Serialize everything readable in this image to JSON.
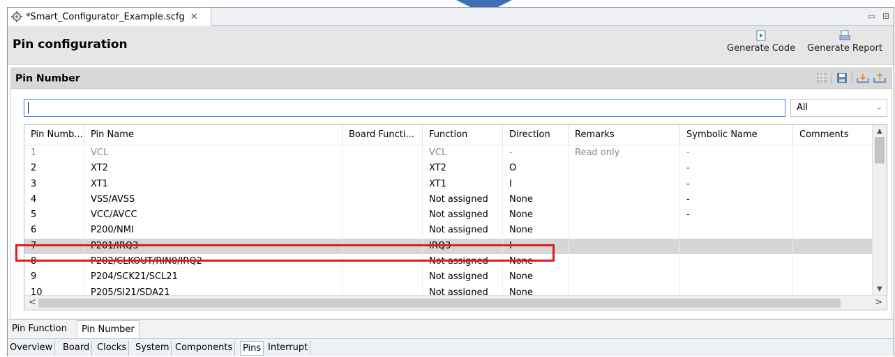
{
  "editor": {
    "tab_title": "*Smart_Configurator_Example.scfg",
    "close_glyph": "✕",
    "minimize_glyph": "▭",
    "maximize_glyph": "⊟"
  },
  "header": {
    "title": "Pin configuration",
    "generate_code": "Generate Code",
    "generate_report": "Generate Report"
  },
  "pane": {
    "title": "Pin Number",
    "search_value": "",
    "filter_selected": "All"
  },
  "table": {
    "columns": [
      "Pin Numb...",
      "Pin Name",
      "Board Functi...",
      "Function",
      "Direction",
      "Remarks",
      "Symbolic Name",
      "Comments"
    ],
    "rows": [
      {
        "pin": "1",
        "name": "VCL",
        "board": "",
        "function": "VCL",
        "direction": "-",
        "remarks": "Read only",
        "symbolic": "-",
        "comments": ""
      },
      {
        "pin": "2",
        "name": "XT2",
        "board": "",
        "function": "XT2",
        "direction": "O",
        "remarks": "",
        "symbolic": "-",
        "comments": ""
      },
      {
        "pin": "3",
        "name": "XT1",
        "board": "",
        "function": "XT1",
        "direction": "I",
        "remarks": "",
        "symbolic": "-",
        "comments": ""
      },
      {
        "pin": "4",
        "name": "VSS/AVSS",
        "board": "",
        "function": "Not assigned",
        "direction": "None",
        "remarks": "",
        "symbolic": "-",
        "comments": ""
      },
      {
        "pin": "5",
        "name": "VCC/AVCC",
        "board": "",
        "function": "Not assigned",
        "direction": "None",
        "remarks": "",
        "symbolic": "-",
        "comments": ""
      },
      {
        "pin": "6",
        "name": "P200/NMI",
        "board": "",
        "function": "Not assigned",
        "direction": "None",
        "remarks": "",
        "symbolic": "",
        "comments": ""
      },
      {
        "pin": "7",
        "name": "P201/IRQ3",
        "board": "",
        "function": "IRQ3",
        "direction": "I",
        "remarks": "",
        "symbolic": "",
        "comments": ""
      },
      {
        "pin": "8",
        "name": "P202/CLKOUT/RIN0/IRQ2",
        "board": "",
        "function": "Not assigned",
        "direction": "None",
        "remarks": "",
        "symbolic": "",
        "comments": ""
      },
      {
        "pin": "9",
        "name": "P204/SCK21/SCL21",
        "board": "",
        "function": "Not assigned",
        "direction": "None",
        "remarks": "",
        "symbolic": "",
        "comments": ""
      },
      {
        "pin": "10",
        "name": "P205/SI21/SDA21",
        "board": "",
        "function": "Not assigned",
        "direction": "None",
        "remarks": "",
        "symbolic": "",
        "comments": ""
      }
    ],
    "selected_pin": "7"
  },
  "subtabs": [
    "Pin Function",
    "Pin Number"
  ],
  "active_subtab": "Pin Number",
  "bottom_tabs": [
    "Overview",
    "Board",
    "Clocks",
    "System",
    "Components",
    "Pins",
    "Interrupt"
  ],
  "active_bottom_tab": "Pins",
  "colors": {
    "highlight": "#e01b1b",
    "pointer": "#3e6fb5",
    "selected_row": "#d6d6d6"
  }
}
